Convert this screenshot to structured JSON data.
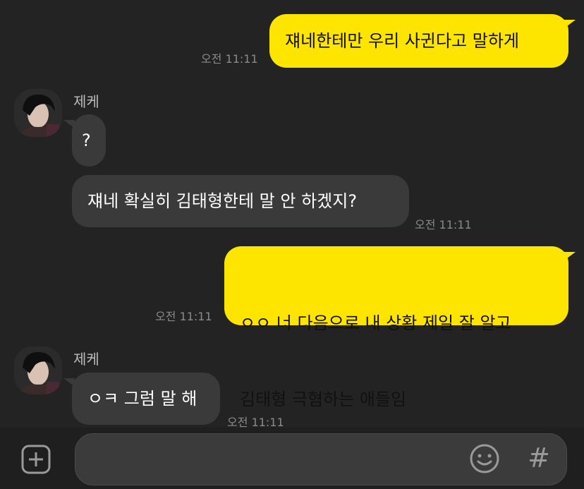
{
  "messages": [
    {
      "side": "me",
      "text": "쟤네한테만 우리 사귄다고 말하게",
      "time": "오전 11:11"
    },
    {
      "side": "them",
      "sender": "제케",
      "text": "?"
    },
    {
      "side": "them",
      "text": "쟤네 확실히 김태형한테 말 안 하겠지?",
      "time": "오전 11:11"
    },
    {
      "side": "me",
      "lines": [
        "ㅇㅇ 너 다음으로 내 상황 제일 잘 알고",
        "김태형 극혐하는 애들임"
      ],
      "time": "오전 11:11"
    },
    {
      "side": "them",
      "sender": "제케",
      "text": "ㅇㅋ 그럼 말 해",
      "time": "오전 11:11"
    }
  ],
  "input_bar": {
    "placeholder": "",
    "hash_label": "#",
    "icons": [
      "plus-icon",
      "emoji-icon",
      "hash-icon"
    ]
  },
  "colors": {
    "background": "#232323",
    "my_bubble": "#FEE500",
    "their_bubble": "#3a3a3a"
  }
}
